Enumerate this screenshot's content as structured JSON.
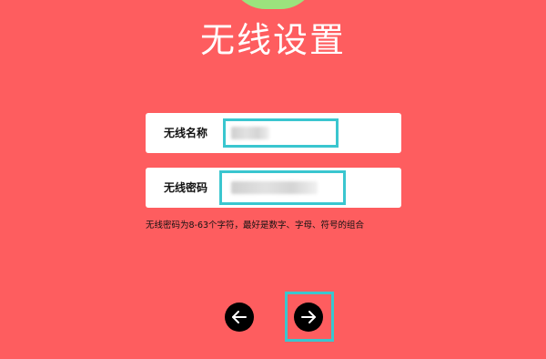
{
  "header": {
    "title": "无线设置"
  },
  "form": {
    "wireless_name_label": "无线名称",
    "wireless_password_label": "无线密码",
    "hint": "无线密码为8-63个字符，最好是数字、字母、符号的组合"
  },
  "navigation": {
    "back_icon": "arrow-left-icon",
    "next_icon": "arrow-right-icon"
  },
  "colors": {
    "background": "#fe5d5f",
    "highlight": "#3ac6cf",
    "accent_green": "#9be37d"
  }
}
